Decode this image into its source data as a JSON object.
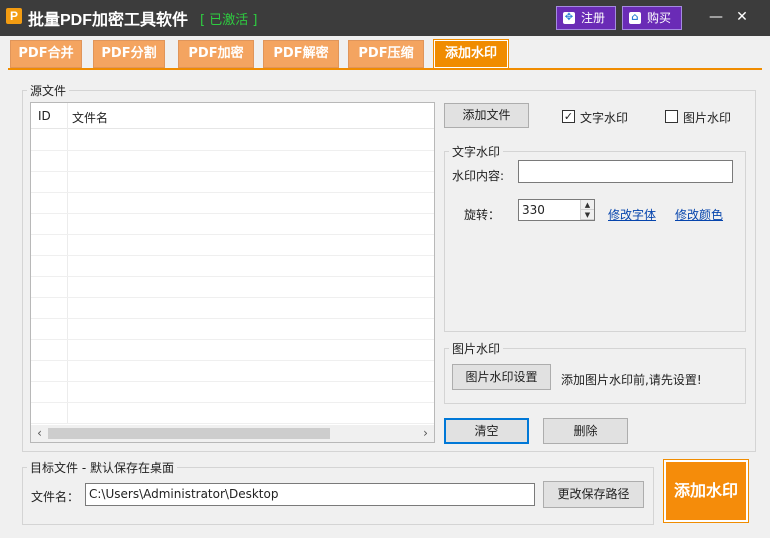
{
  "window": {
    "title": "批量PDF加密工具软件",
    "status": "[ 已激活 ]",
    "register_label": "注册",
    "buy_label": "购买",
    "minimize": "—",
    "close": "✕"
  },
  "tabs": [
    {
      "label": "PDF合并"
    },
    {
      "label": "PDF分割"
    },
    {
      "label": "PDF加密"
    },
    {
      "label": "PDF解密"
    },
    {
      "label": "PDF压缩"
    },
    {
      "label": "添加水印",
      "active": true
    }
  ],
  "source": {
    "group_label": "源文件",
    "columns": [
      "ID",
      "文件名"
    ],
    "rows": []
  },
  "controls": {
    "add_file": "添加文件",
    "text_watermark_check": "文字水印",
    "text_watermark_checked": true,
    "image_watermark_check": "图片水印",
    "image_watermark_checked": false,
    "clear": "清空",
    "delete": "删除"
  },
  "text_watermark": {
    "group_label": "文字水印",
    "content_label": "水印内容:",
    "content_value": "",
    "rotate_label": "旋转：",
    "rotate_value": "330",
    "change_font": "修改字体",
    "change_color": "修改颜色"
  },
  "image_watermark": {
    "group_label": "图片水印",
    "settings_button": "图片水印设置",
    "hint": "添加图片水印前,请先设置!"
  },
  "target": {
    "group_label": "目标文件 - 默认保存在桌面",
    "filename_label": "文件名：",
    "path_value": "C:\\Users\\Administrator\\Desktop",
    "change_path": "更改保存路径"
  },
  "action": {
    "add_watermark": "添加水印"
  },
  "colors": {
    "titlebar": "#3c3c3c",
    "tab": "#f4a460",
    "tab_active": "#f08c00",
    "accent_button": "#6a2bb6",
    "activated_text": "#2ecc40"
  }
}
